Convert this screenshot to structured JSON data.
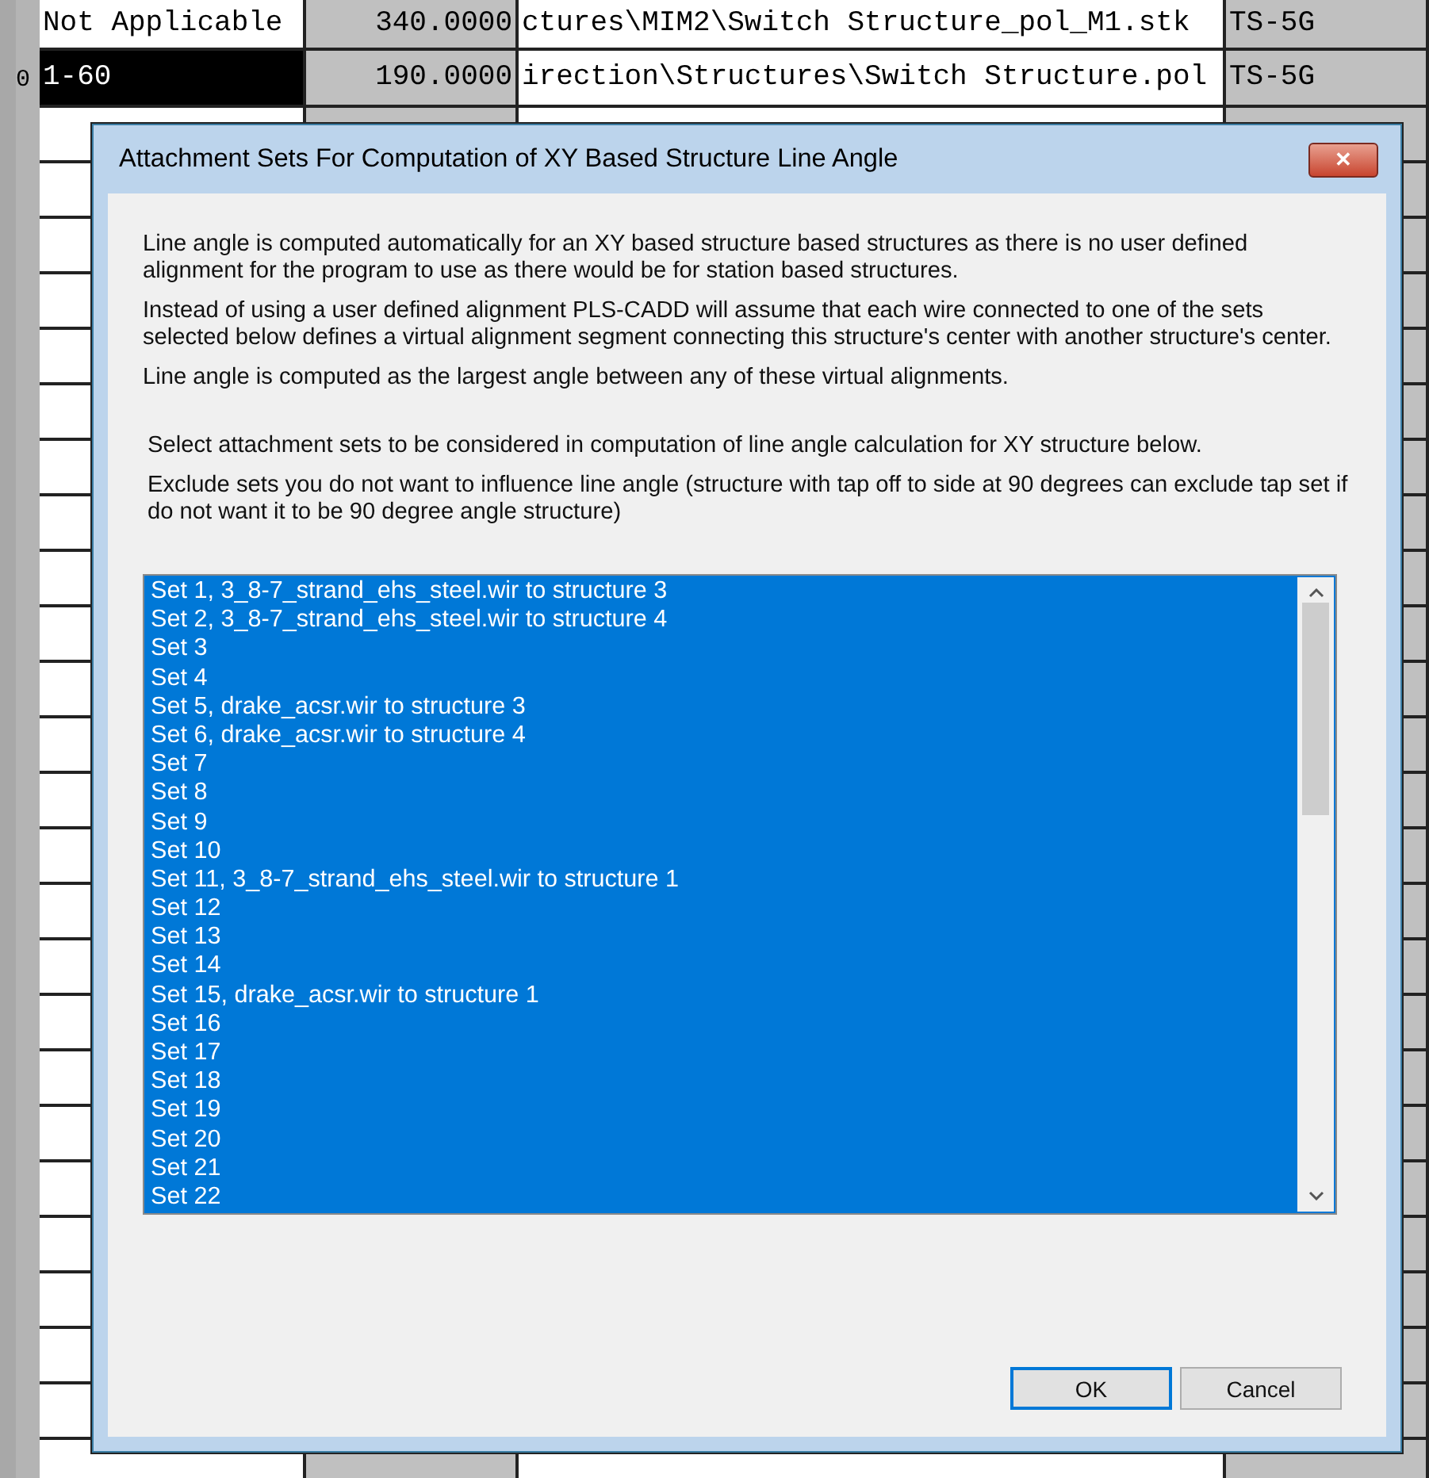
{
  "grid": {
    "rows": [
      {
        "row_header": "",
        "selected": false,
        "cells": [
          "Not Applicable",
          "340.0000",
          "ctures\\MIM2\\Switch Structure_pol_M1.stk",
          "TS-5G"
        ]
      },
      {
        "row_header": "0",
        "selected": true,
        "cells": [
          "1-60",
          "190.0000",
          "irection\\Structures\\Switch Structure.pol",
          "TS-5G"
        ]
      }
    ]
  },
  "dialog": {
    "title": "Attachment Sets For Computation of XY Based Structure Line Angle",
    "close_label": "✕",
    "intro": [
      "Line angle is computed automatically for an XY based structure based structures as there is no user defined alignment for the program to use as there would be for station based structures.",
      "Instead of using a user defined alignment PLS-CADD will assume that each wire connected to one of the sets selected below defines a virtual alignment segment connecting this structure's center with another structure's center.",
      "Line angle is computed as the largest angle between any of these virtual alignments."
    ],
    "instructions": [
      "Select attachment sets to be considered in computation of line angle calculation for XY structure below.",
      "Exclude sets you do not want to influence line angle (structure with tap off to side at 90 degrees can exclude tap set if do not want it to be 90 degree angle structure)"
    ],
    "sets": [
      {
        "label": "Set 1, 3_8-7_strand_ehs_steel.wir to structure 3",
        "selected": true
      },
      {
        "label": "Set 2, 3_8-7_strand_ehs_steel.wir to structure 4",
        "selected": true
      },
      {
        "label": "Set 3",
        "selected": true
      },
      {
        "label": "Set 4",
        "selected": true
      },
      {
        "label": "Set 5, drake_acsr.wir to structure 3",
        "selected": true
      },
      {
        "label": "Set 6, drake_acsr.wir to structure 4",
        "selected": true
      },
      {
        "label": "Set 7",
        "selected": true
      },
      {
        "label": "Set 8",
        "selected": true
      },
      {
        "label": "Set 9",
        "selected": true
      },
      {
        "label": "Set 10",
        "selected": true
      },
      {
        "label": "Set 11, 3_8-7_strand_ehs_steel.wir to structure 1",
        "selected": true
      },
      {
        "label": "Set 12",
        "selected": true
      },
      {
        "label": "Set 13",
        "selected": true
      },
      {
        "label": "Set 14",
        "selected": true
      },
      {
        "label": "Set 15, drake_acsr.wir to structure 1",
        "selected": true
      },
      {
        "label": "Set 16",
        "selected": true
      },
      {
        "label": "Set 17",
        "selected": true
      },
      {
        "label": "Set 18",
        "selected": true
      },
      {
        "label": "Set 19",
        "selected": true
      },
      {
        "label": "Set 20",
        "selected": true
      },
      {
        "label": "Set 21",
        "selected": true
      },
      {
        "label": "Set 22",
        "selected": true
      }
    ],
    "buttons": [
      {
        "label": "OK",
        "default": true
      },
      {
        "label": "Cancel",
        "default": false
      }
    ]
  }
}
